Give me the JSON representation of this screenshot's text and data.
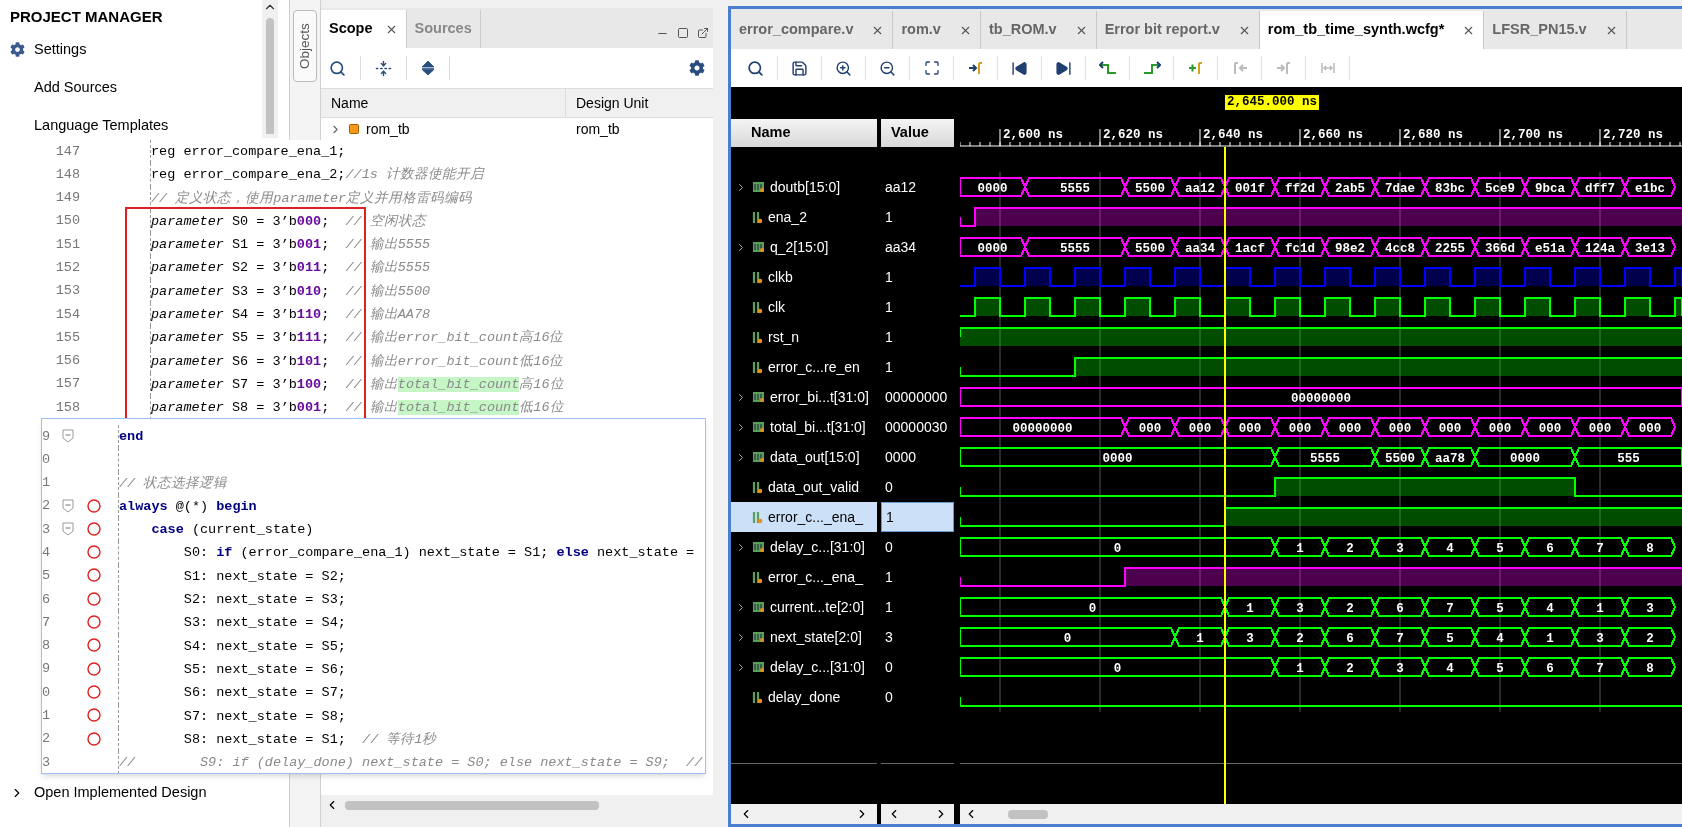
{
  "project_manager": {
    "title": "PROJECT MANAGER",
    "items": [
      {
        "label": "Settings",
        "kind": "settings"
      },
      {
        "label": "Add Sources",
        "kind": "plain"
      },
      {
        "label": "Language Templates",
        "kind": "plain"
      }
    ],
    "bottom_item": {
      "label": "Open Implemented Design",
      "expanded": false
    }
  },
  "side_tab": {
    "label": "Objects"
  },
  "scope_panel": {
    "tabs": [
      {
        "label": "Scope",
        "selected": true
      },
      {
        "label": "Sources",
        "selected": false
      }
    ],
    "columns": [
      "Name",
      "Design Unit"
    ],
    "rows": [
      {
        "name": "rom_tb",
        "design_unit": "rom_tb",
        "expanded": false
      }
    ]
  },
  "code_snippets": [
    {
      "lines": [
        {
          "number": "147",
          "boxed": false,
          "tokens": [
            {
              "kind": "plain",
              "text": "reg error_compare_ena_1;"
            }
          ]
        },
        {
          "number": "148",
          "boxed": false,
          "tokens": [
            {
              "kind": "plain",
              "text": "reg error_compare_ena_2;"
            },
            {
              "kind": "comment",
              "text": "//1s 计数器使能开启"
            }
          ]
        },
        {
          "number": "149",
          "boxed": false,
          "tokens": [
            {
              "kind": "comment",
              "text": "// 定义状态，使用parameter定义并用格雷码编码"
            }
          ]
        },
        {
          "number": "150",
          "boxed": true,
          "tokens": [
            {
              "kind": "param",
              "text": "parameter"
            },
            {
              "kind": "plain",
              "text": " S0 = 3’b"
            },
            {
              "kind": "number",
              "text": "000"
            },
            {
              "kind": "plain",
              "text": ";  "
            },
            {
              "kind": "comment",
              "text": "// 空闲状态"
            }
          ]
        },
        {
          "number": "151",
          "boxed": true,
          "tokens": [
            {
              "kind": "param",
              "text": "parameter"
            },
            {
              "kind": "plain",
              "text": " S1 = 3’b"
            },
            {
              "kind": "number",
              "text": "001"
            },
            {
              "kind": "plain",
              "text": ";  "
            },
            {
              "kind": "comment",
              "text": "// 输出5555"
            }
          ]
        },
        {
          "number": "152",
          "boxed": true,
          "tokens": [
            {
              "kind": "param",
              "text": "parameter"
            },
            {
              "kind": "plain",
              "text": " S2 = 3’b"
            },
            {
              "kind": "number",
              "text": "011"
            },
            {
              "kind": "plain",
              "text": ";  "
            },
            {
              "kind": "comment",
              "text": "// 输出5555"
            }
          ]
        },
        {
          "number": "153",
          "boxed": true,
          "tokens": [
            {
              "kind": "param",
              "text": "parameter"
            },
            {
              "kind": "plain",
              "text": " S3 = 3’b"
            },
            {
              "kind": "number",
              "text": "010"
            },
            {
              "kind": "plain",
              "text": ";  "
            },
            {
              "kind": "comment",
              "text": "// 输出5500"
            }
          ]
        },
        {
          "number": "154",
          "boxed": true,
          "tokens": [
            {
              "kind": "param",
              "text": "parameter"
            },
            {
              "kind": "plain",
              "text": " S4 = 3’b"
            },
            {
              "kind": "number",
              "text": "110"
            },
            {
              "kind": "plain",
              "text": ";  "
            },
            {
              "kind": "comment",
              "text": "// 输出AA78"
            }
          ]
        },
        {
          "number": "155",
          "boxed": true,
          "tokens": [
            {
              "kind": "param",
              "text": "parameter"
            },
            {
              "kind": "plain",
              "text": " S5 = 3’b"
            },
            {
              "kind": "number",
              "text": "111"
            },
            {
              "kind": "plain",
              "text": ";  "
            },
            {
              "kind": "comment",
              "text": "// 输出error_bit_count高16位"
            }
          ]
        },
        {
          "number": "156",
          "boxed": true,
          "tokens": [
            {
              "kind": "param",
              "text": "parameter"
            },
            {
              "kind": "plain",
              "text": " S6 = 3’b"
            },
            {
              "kind": "number",
              "text": "101"
            },
            {
              "kind": "plain",
              "text": ";  "
            },
            {
              "kind": "comment",
              "text": "// 输出error_bit_count低16位"
            }
          ]
        },
        {
          "number": "157",
          "boxed": true,
          "tokens": [
            {
              "kind": "param",
              "text": "parameter"
            },
            {
              "kind": "plain",
              "text": " S7 = 3’b"
            },
            {
              "kind": "number",
              "text": "100"
            },
            {
              "kind": "plain",
              "text": ";  "
            },
            {
              "kind": "comment",
              "text": "// 输出"
            },
            {
              "kind": "match",
              "text": "total_bit_count"
            },
            {
              "kind": "comment",
              "text": "高16位"
            }
          ]
        },
        {
          "number": "158",
          "boxed": true,
          "tokens": [
            {
              "kind": "param",
              "text": "parameter"
            },
            {
              "kind": "plain",
              "text": " S8 = 3’b"
            },
            {
              "kind": "number",
              "text": "001"
            },
            {
              "kind": "plain",
              "text": ";  "
            },
            {
              "kind": "comment",
              "text": "// 输出"
            },
            {
              "kind": "match",
              "text": "total_bit_count"
            },
            {
              "kind": "comment",
              "text": "低16位"
            }
          ]
        }
      ]
    },
    {
      "lines": [
        {
          "number": "9",
          "fold": true,
          "breakpoint": false,
          "tokens": [
            {
              "kind": "keyword",
              "text": "end"
            }
          ]
        },
        {
          "number": "0",
          "fold": false,
          "breakpoint": false
        },
        {
          "number": "1",
          "fold": false,
          "breakpoint": false,
          "tokens": [
            {
              "kind": "comment",
              "text": "// 状态选择逻辑"
            }
          ]
        },
        {
          "number": "2",
          "fold": true,
          "breakpoint": true,
          "tokens": [
            {
              "kind": "keyword",
              "text": "always"
            },
            {
              "kind": "plain",
              "text": " @(*) "
            },
            {
              "kind": "keyword",
              "text": "begin"
            }
          ]
        },
        {
          "number": "3",
          "fold": true,
          "breakpoint": true,
          "tokens": [
            {
              "kind": "keyword",
              "text": "    case"
            },
            {
              "kind": "plain",
              "text": " (current_state)"
            }
          ]
        },
        {
          "number": "4",
          "fold": false,
          "breakpoint": true,
          "tokens": [
            {
              "kind": "plain",
              "text": "        S0: "
            },
            {
              "kind": "keyword",
              "text": "if"
            },
            {
              "kind": "plain",
              "text": " (error_compare_ena_1) next_state = S1; "
            },
            {
              "kind": "keyword",
              "text": "else"
            },
            {
              "kind": "plain",
              "text": " next_state ="
            }
          ]
        },
        {
          "number": "5",
          "fold": false,
          "breakpoint": true,
          "tokens": [
            {
              "kind": "plain",
              "text": "        S1: next_state = S2;"
            }
          ]
        },
        {
          "number": "6",
          "fold": false,
          "breakpoint": true,
          "tokens": [
            {
              "kind": "plain",
              "text": "        S2: next_state = S3;"
            }
          ]
        },
        {
          "number": "7",
          "fold": false,
          "breakpoint": true,
          "tokens": [
            {
              "kind": "plain",
              "text": "        S3: next_state = S4;"
            }
          ]
        },
        {
          "number": "8",
          "fold": false,
          "breakpoint": true,
          "tokens": [
            {
              "kind": "plain",
              "text": "        S4: next_state = S5;"
            }
          ]
        },
        {
          "number": "9",
          "fold": false,
          "breakpoint": true,
          "tokens": [
            {
              "kind": "plain",
              "text": "        S5: next_state = S6;"
            }
          ]
        },
        {
          "number": "0",
          "fold": false,
          "breakpoint": true,
          "tokens": [
            {
              "kind": "plain",
              "text": "        S6: next_state = S7;"
            }
          ]
        },
        {
          "number": "1",
          "fold": false,
          "breakpoint": true,
          "tokens": [
            {
              "kind": "plain",
              "text": "        S7: next_state = S8;"
            }
          ]
        },
        {
          "number": "2",
          "fold": false,
          "breakpoint": true,
          "tokens": [
            {
              "kind": "plain",
              "text": "        S8: next_state = S1;  "
            },
            {
              "kind": "comment",
              "text": "// 等待1秒"
            }
          ]
        },
        {
          "number": "3",
          "fold": false,
          "breakpoint": false,
          "tokens": [
            {
              "kind": "comment",
              "text": "//        S9: if (delay_done) next_state = S0; else next_state = S9;  //"
            }
          ]
        }
      ]
    }
  ],
  "waveform_window": {
    "tabs": [
      {
        "label": "error_compare.v",
        "selected": false
      },
      {
        "label": "rom.v",
        "selected": false
      },
      {
        "label": "tb_ROM.v",
        "selected": false
      },
      {
        "label": "Error bit report.v",
        "selected": false
      },
      {
        "label": "rom_tb_time_synth.wcfg*",
        "selected": true
      },
      {
        "label": "LFSR_PN15.v",
        "selected": false
      }
    ],
    "toolbar": [
      {
        "kind": "search",
        "disabled": false
      },
      {
        "kind": "save",
        "disabled": false
      },
      {
        "kind": "zoom_in",
        "disabled": false
      },
      {
        "kind": "zoom_out",
        "disabled": false
      },
      {
        "kind": "zoom_fit",
        "disabled": false
      },
      {
        "kind": "go_to_cursor",
        "disabled": false
      },
      {
        "kind": "go_to_start",
        "disabled": false
      },
      {
        "kind": "go_to_end",
        "disabled": false
      },
      {
        "kind": "prev_transition",
        "disabled": false
      },
      {
        "kind": "next_transition",
        "disabled": false
      },
      {
        "kind": "add_marker",
        "disabled": false
      },
      {
        "kind": "prev_marker",
        "disabled": true
      },
      {
        "kind": "next_marker",
        "disabled": true
      },
      {
        "kind": "swap_cursors",
        "disabled": true
      }
    ],
    "columns": [
      "Name",
      "Value"
    ],
    "cursor": {
      "label": "2,645.000 ns"
    },
    "ruler": [
      "2,600 ns",
      "2,620 ns",
      "2,640 ns",
      "2,660 ns",
      "2,680 ns",
      "2,700 ns",
      "2,720 ns"
    ],
    "signals": [
      {
        "name": "doutb[15:0]",
        "value": "aa12",
        "kind": "bus",
        "color": "#ff00ff",
        "selected": false,
        "segments": [
          "0000",
          "5555",
          "5500",
          "aa12",
          "001f",
          "ff2d",
          "2ab5",
          "7dae",
          "83bc",
          "5ce9",
          "9bca",
          "dff7",
          "e1bc"
        ]
      },
      {
        "name": "ena_2",
        "value": "1",
        "kind": "bit",
        "color": "#ff00ff",
        "selected": false,
        "segments": [
          {
            "high": false
          },
          {
            "high": true
          }
        ]
      },
      {
        "name": "q_2[15:0]",
        "value": "aa34",
        "kind": "bus",
        "color": "#ff00ff",
        "selected": false,
        "segments": [
          "0000",
          "5555",
          "5500",
          "aa34",
          "1acf",
          "fc1d",
          "98e2",
          "4cc8",
          "2255",
          "366d",
          "e51a",
          "124a",
          "3e13"
        ]
      },
      {
        "name": "clkb",
        "value": "1",
        "kind": "clock",
        "color": "#0000ff",
        "selected": false
      },
      {
        "name": "clk",
        "value": "1",
        "kind": "clock",
        "color": "#00ff00",
        "selected": false
      },
      {
        "name": "rst_n",
        "value": "1",
        "kind": "bit",
        "color": "#00ff00",
        "selected": false,
        "segments": [
          {
            "high": true
          }
        ]
      },
      {
        "name": "error_c...re_en",
        "value": "1",
        "kind": "bit",
        "color": "#00ff00",
        "selected": false,
        "segments": [
          {
            "high": false
          },
          {
            "high": true
          }
        ]
      },
      {
        "name": "error_bi...t[31:0]",
        "value": "00000000",
        "kind": "bus",
        "color": "#ff00ff",
        "selected": false,
        "segments": [
          "00000000"
        ]
      },
      {
        "name": "total_bi...t[31:0]",
        "value": "00000030",
        "kind": "bus",
        "color": "#ff00ff",
        "selected": false,
        "segments": [
          "00000000",
          "000",
          "000",
          "000",
          "000",
          "000",
          "000",
          "000",
          "000",
          "000",
          "000",
          "000"
        ]
      },
      {
        "name": "data_out[15:0]",
        "value": "0000",
        "kind": "bus",
        "color": "#00ff00",
        "selected": false,
        "segments": [
          "0000",
          "5555",
          "5500",
          "aa78",
          "0000",
          "555"
        ]
      },
      {
        "name": "data_out_valid",
        "value": "0",
        "kind": "bit",
        "color": "#00ff00",
        "selected": false,
        "segments": [
          {
            "high": false
          },
          {
            "high": true
          },
          {
            "high": false
          }
        ]
      },
      {
        "name": "error_c..._ena_",
        "value": "1",
        "kind": "bit",
        "color": "#00ff00",
        "selected": true,
        "segments": [
          {
            "high": false
          },
          {
            "high": true
          }
        ]
      },
      {
        "name": "delay_c...[31:0]",
        "value": "0",
        "kind": "bus",
        "color": "#00ff00",
        "selected": false,
        "segments": [
          "0",
          "1",
          "2",
          "3",
          "4",
          "5",
          "6",
          "7",
          "8"
        ]
      },
      {
        "name": "error_c..._ena_",
        "value": "1",
        "kind": "bit",
        "color": "#ff00ff",
        "selected": false,
        "segments": [
          {
            "high": false
          },
          {
            "high": true
          }
        ]
      },
      {
        "name": "current...te[2:0]",
        "value": "1",
        "kind": "bus",
        "color": "#00ff00",
        "selected": false,
        "segments": [
          "0",
          "1",
          "3",
          "2",
          "6",
          "7",
          "5",
          "4",
          "1",
          "3"
        ]
      },
      {
        "name": "next_state[2:0]",
        "value": "3",
        "kind": "bus",
        "color": "#00ff00",
        "selected": false,
        "segments": [
          "0",
          "1",
          "3",
          "2",
          "6",
          "7",
          "5",
          "4",
          "1",
          "3",
          "2"
        ]
      },
      {
        "name": "delay_c...[31:0]",
        "value": "0",
        "kind": "bus",
        "color": "#00ff00",
        "selected": false,
        "segments": [
          "0",
          "1",
          "2",
          "3",
          "4",
          "5",
          "6",
          "7",
          "8"
        ]
      },
      {
        "name": "delay_done",
        "value": "0",
        "kind": "bit",
        "color": "#00ff00",
        "selected": false,
        "segments": [
          {
            "high": false
          }
        ]
      }
    ]
  }
}
